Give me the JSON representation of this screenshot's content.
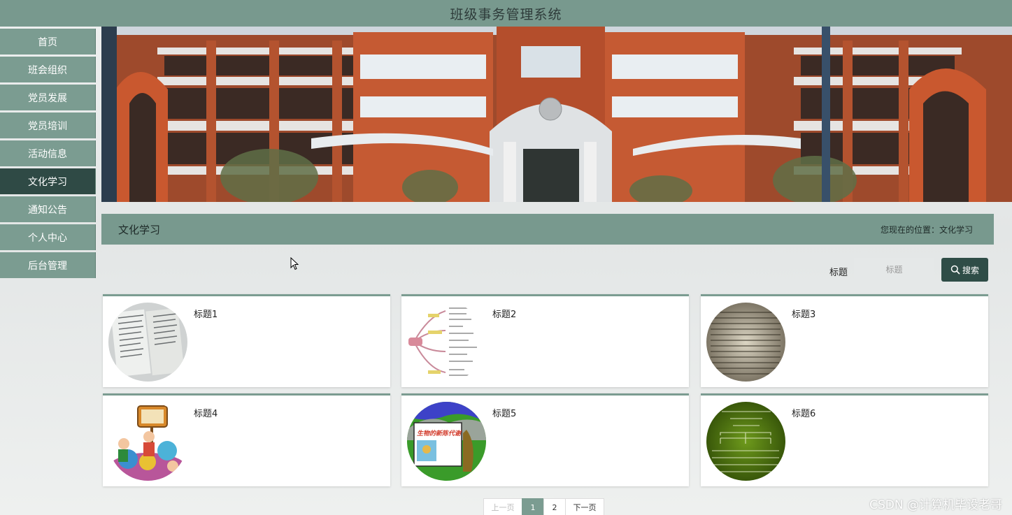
{
  "header": {
    "title": "班级事务管理系统"
  },
  "sidebar": {
    "items": [
      {
        "label": "首页"
      },
      {
        "label": "班会组织"
      },
      {
        "label": "党员发展"
      },
      {
        "label": "党员培训"
      },
      {
        "label": "活动信息"
      },
      {
        "label": "文化学习"
      },
      {
        "label": "通知公告"
      },
      {
        "label": "个人中心"
      },
      {
        "label": "后台管理"
      }
    ],
    "active": "文化学习"
  },
  "section": {
    "title": "文化学习",
    "location": "您现在的位置：文化学习"
  },
  "search": {
    "label": "标题",
    "placeholder": "标题",
    "button_label": "搜索",
    "icon": "search-icon"
  },
  "cards": [
    {
      "title": "标题1"
    },
    {
      "title": "标题2"
    },
    {
      "title": "标题3"
    },
    {
      "title": "标题4"
    },
    {
      "title": "标题5"
    },
    {
      "title": "标题6"
    }
  ],
  "card5_image_text": "生物的新陈代谢",
  "pagination": {
    "prev": "上一页",
    "pages": [
      "1",
      "2"
    ],
    "current": "1",
    "next": "下一页"
  },
  "watermark": "CSDN @计算机毕设老哥",
  "colors": {
    "accent": "#78998e",
    "active_nav": "#2f4a45",
    "button": "#2f4d47"
  }
}
